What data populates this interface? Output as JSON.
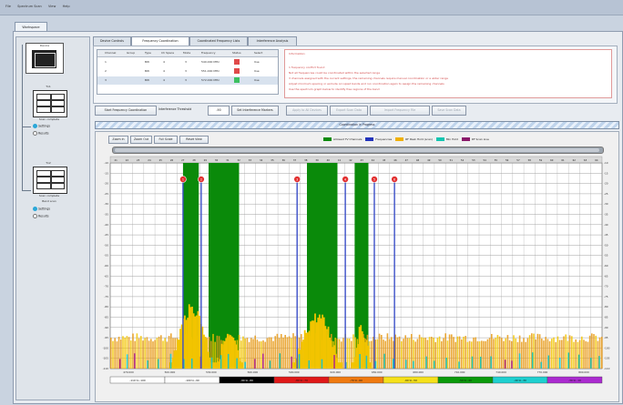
{
  "menu": [
    "File",
    "Spectrum Scan",
    "View",
    "Help"
  ],
  "workspace_tab": "Workspace",
  "left_panel": {
    "top_box_label": "Device",
    "group1_title": "Tx1",
    "group1_status": "Scan complete",
    "group1_opt1": "Settings",
    "group1_opt2": "Results",
    "group2_title": "Tx2",
    "group2_status": "Scan complete",
    "group2_sub": "Band scan",
    "group2_opt1": "Settings",
    "group2_opt2": "Results"
  },
  "tabs": [
    "Device Controls",
    "Frequency Coordination",
    "Coordinated Frequency Lists",
    "Interference Analysis"
  ],
  "active_tab": 1,
  "freq_table": {
    "headers": [
      "Channel",
      "Group",
      "Type",
      "Ch Space",
      "Mode",
      "Frequency",
      "Status",
      "Select"
    ],
    "rows": [
      [
        "1",
        "",
        "BW",
        "4",
        "3",
        "540.000 MHz",
        "",
        "Use"
      ],
      [
        "2",
        "",
        "BW",
        "4",
        "3",
        "551.000 MHz",
        "",
        "Use"
      ],
      [
        "3",
        "",
        "BW",
        "4",
        "3",
        "572.000 MHz",
        "",
        "Use"
      ]
    ]
  },
  "info_panel": [
    "Information:",
    "1 frequency conflict found",
    "Not all frequencies could be coordinated within the selected range",
    "3 channels assigned with the current settings, the remaining channels require manual coordination or a wider range",
    "Adjust minimum spacing or exclude occupied bands and run coordination again to assign the remaining channels",
    "Use the spectrum graph below to identify free regions of the band"
  ],
  "buttons": {
    "start": "Start Frequency Coordination",
    "threshold_label": "Interference Threshold",
    "threshold_value": "-90",
    "reset": "Set Interference Markers",
    "b1": "Apply to All Devices",
    "b2": "Export Scan Data",
    "b3": "Import Frequency File",
    "b4": "Save Scan Data"
  },
  "progress_label": "Coordination in Progress",
  "chart_toolbar": [
    "Zoom In",
    "Zoom Out",
    "Full Scale",
    "Reset View"
  ],
  "legend": [
    {
      "label": "Allowed TV Channels",
      "color": "#0a8a0a"
    },
    {
      "label": "Frequencies",
      "color": "#2233bb"
    },
    {
      "label": "RF Peak Hold (scan)",
      "color": "#f0b000"
    },
    {
      "label": "Min Hold",
      "color": "#11c5b0"
    },
    {
      "label": "RF Scan Live",
      "color": "#8a1a6a"
    }
  ],
  "colors": {
    "green": "#0a8a0a",
    "blue": "#3b4fc8",
    "yellow": "#f2c400",
    "orange": "#e79a16",
    "cyan": "#22c4bd",
    "magenta": "#b02a8a",
    "marker": "#e23030"
  },
  "chart_data": {
    "type": "area",
    "y_ticks": [
      "-10",
      "-15",
      "-20",
      "-25",
      "-30",
      "-35",
      "-40",
      "-45",
      "-50",
      "-55",
      "-60",
      "-65",
      "-70",
      "-75",
      "-80",
      "-85",
      "-90",
      "-95",
      "-100",
      "-105",
      "-110"
    ],
    "x_ticks": [
      "470.000",
      "500.000",
      "530.000",
      "560.000",
      "590.000",
      "620.000",
      "650.000",
      "680.000",
      "710.000",
      "740.000",
      "770.000",
      "800.000"
    ],
    "channel_labels": [
      "21",
      "22",
      "23",
      "24",
      "25",
      "26",
      "27",
      "28",
      "29",
      "30",
      "31",
      "32",
      "33",
      "34",
      "35",
      "36",
      "37",
      "38",
      "39",
      "40",
      "41",
      "42",
      "43",
      "44",
      "45",
      "46",
      "47",
      "48",
      "49",
      "50",
      "51",
      "52",
      "53",
      "54",
      "55",
      "56",
      "57",
      "58",
      "59",
      "60",
      "61",
      "62",
      "63",
      "64"
    ],
    "green_bands": [
      [
        0.148,
        0.18
      ],
      [
        0.2,
        0.262
      ],
      [
        0.4,
        0.462
      ],
      [
        0.497,
        0.525
      ]
    ],
    "markers": [
      {
        "label": "1",
        "x": 0.148
      },
      {
        "label": "2",
        "x": 0.185
      },
      {
        "label": "3",
        "x": 0.38
      },
      {
        "label": "4",
        "x": 0.478
      },
      {
        "label": "5",
        "x": 0.537
      },
      {
        "label": "6",
        "x": 0.578
      }
    ],
    "color_bar": [
      {
        "label": "-110 to -100",
        "color": "#ffffff"
      },
      {
        "label": "-100 to -90",
        "color": "#ffffff"
      },
      {
        "label": "-90 to -80",
        "color": "#000000"
      },
      {
        "label": "-80 to -70",
        "color": "#e01818"
      },
      {
        "label": "-70 to -60",
        "color": "#f07a10"
      },
      {
        "label": "-60 to -50",
        "color": "#f6e11a"
      },
      {
        "label": "-50 to -40",
        "color": "#0a9a0a"
      },
      {
        "label": "-40 to -30",
        "color": "#1ed0d0"
      },
      {
        "label": "-30 to -10",
        "color": "#ab2bd0"
      }
    ]
  }
}
